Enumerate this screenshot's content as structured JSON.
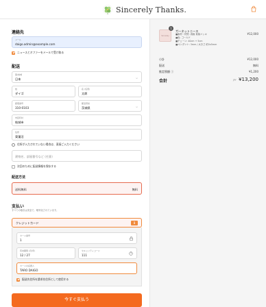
{
  "header": {
    "logo_text": "Sincerely Thanks.",
    "cart_icon": "shopping-bag-icon",
    "accent_color": "#f08a3c"
  },
  "contact": {
    "title": "連絡先",
    "email_label": "メール",
    "email_value": "daigo.admin@example.com",
    "newsletter_label": "ニュースとオファーをメールで受け取る"
  },
  "delivery": {
    "title": "配送",
    "country_label": "国/地域",
    "country_value": "日本",
    "last_name_label": "姓",
    "last_name_value": "ダイゴ",
    "first_name_label": "名 (任意)",
    "first_name_value": "太郎",
    "zip_label": "郵便番号",
    "zip_value": "310-0103",
    "prefecture_label": "都道府県",
    "prefecture_value": "茨城県",
    "city_label": "市区町村",
    "city_value": "結城市",
    "address_label": "住所",
    "address_value": "東蓮沼",
    "address_hint": "住所が入力されていない場合は、直接ご入力ください",
    "building_placeholder": "建物名、部屋番号など (任意)",
    "save_info_label": "次回のために配送情報を保存する"
  },
  "shipping": {
    "title": "配送方法",
    "method_label": "送料無料",
    "method_price": "無料"
  },
  "payment": {
    "title": "支払い",
    "subtitle": "すべての取引は安全で、暗号化されています。",
    "method_label": "クレジットカード",
    "card_badge": "B",
    "card_number_label": "カード番号",
    "card_number_value": "1",
    "expiry_label": "有効期限 (月/年)",
    "expiry_value": "12 / 27",
    "cvv_label": "セキュリティコード",
    "cvv_value": "111",
    "name_label": "カードの名義人",
    "name_value": "TARO DAIGO",
    "billing_same_label": "配送先住所を請求先住所として使用する",
    "pay_button": "今すぐ支払う"
  },
  "summary": {
    "product_name": "ガーネットニース",
    "product_detail_1": "■素材・材質: 真鍮 真鍮メッキ",
    "product_detail_2": "■色: ゴールド",
    "product_detail_3": "■チェーン: 40cm + 5cm",
    "product_detail_4": "■ペンダント: 3mm / 大きさ 約5x5mm",
    "product_thumb_text": "Sincerely",
    "product_price": "¥12,000",
    "quantity": "1",
    "subtotal_label": "小計",
    "subtotal_value": "¥12,000",
    "shipping_label": "配送",
    "shipping_value": "無料",
    "tax_label": "推定税額 ⓘ",
    "tax_value": "¥1,200",
    "total_label": "合計",
    "total_currency": "JPY",
    "total_value": "¥13,200"
  }
}
